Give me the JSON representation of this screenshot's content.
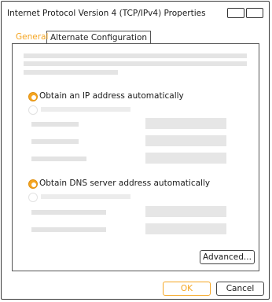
{
  "window": {
    "title": "Internet Protocol Version 4 (TCP/IPv4) Properties"
  },
  "tabs": [
    {
      "label": "General",
      "selected": true
    },
    {
      "label": "Alternate Configuration",
      "selected": false
    }
  ],
  "ip_section": {
    "auto_label": "Obtain an IP address automatically",
    "auto_selected": true
  },
  "dns_section": {
    "auto_label": "Obtain DNS server address automatically",
    "auto_selected": true
  },
  "buttons": {
    "advanced": "Advanced...",
    "ok": "OK",
    "cancel": "Cancel"
  },
  "colors": {
    "accent": "#f5a623",
    "placeholder": "#e4e4e4"
  }
}
